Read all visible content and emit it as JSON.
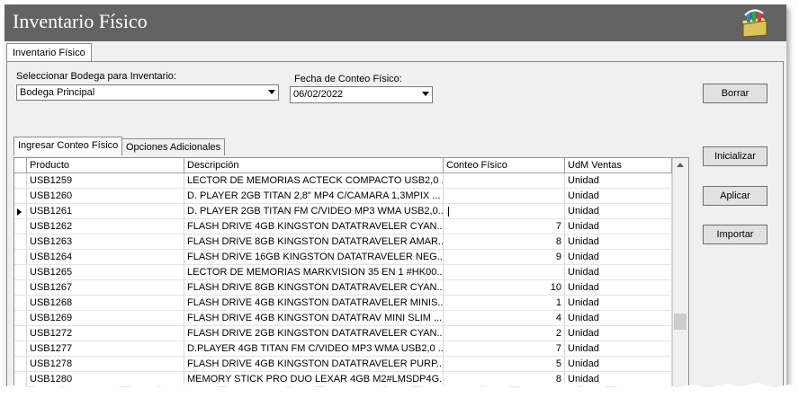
{
  "window": {
    "title": "Inventario Físico",
    "tab": "Inventario Físico",
    "icon": "inventory-app-icon"
  },
  "bodega": {
    "label": "Seleccionar Bodega para Inventario:",
    "value": "Bodega Principal"
  },
  "fecha": {
    "label": "Fecha de Conteo Físico:",
    "value": "06/02/2022"
  },
  "buttons": {
    "borrar": "Borrar",
    "inicializar": "Inicializar",
    "aplicar": "Aplicar",
    "importar": "Importar"
  },
  "tabs": [
    {
      "label": "Ingresar Conteo Físico"
    },
    {
      "label": "Opciones Adicionales"
    }
  ],
  "grid": {
    "columns": [
      "Producto",
      "Descripción",
      "Conteo Físico",
      "UdM Ventas"
    ],
    "rows": [
      {
        "producto": "USB1259",
        "descripcion": "LECTOR DE MEMORIAS ACTECK COMPACTO USB2,0 ...",
        "conteo": "",
        "udm": "Unidad"
      },
      {
        "producto": "USB1260",
        "descripcion": "D. PLAYER 2GB TITAN 2,8\" MP4 C/CAMARA 1,3MPIX ...",
        "conteo": "",
        "udm": "Unidad"
      },
      {
        "producto": "USB1261",
        "descripcion": "D. PLAYER 2GB TITAN FM C/VIDEO MP3 WMA USB2,0...",
        "conteo": "",
        "udm": "Unidad"
      },
      {
        "producto": "USB1262",
        "descripcion": "FLASH DRIVE 4GB KINGSTON DATATRAVELER CYAN...",
        "conteo": "7",
        "udm": "Unidad"
      },
      {
        "producto": "USB1263",
        "descripcion": "FLASH DRIVE 8GB KINGSTON DATATRAVELER AMAR...",
        "conteo": "8",
        "udm": "Unidad"
      },
      {
        "producto": "USB1264",
        "descripcion": "FLASH DRIVE 16GB KINGSTON DATATRAVELER NEG...",
        "conteo": "9",
        "udm": "Unidad"
      },
      {
        "producto": "USB1265",
        "descripcion": "LECTOR DE MEMORIAS MARKVISION 35 EN 1 #HK00...",
        "conteo": "",
        "udm": "Unidad"
      },
      {
        "producto": "USB1267",
        "descripcion": "FLASH DRIVE 8GB KINGSTON DATATRAVELER CYAN...",
        "conteo": "10",
        "udm": "Unidad"
      },
      {
        "producto": "USB1268",
        "descripcion": "FLASH DRIVE 4GB KINGSTON DATATRAVELER MINIS...",
        "conteo": "1",
        "udm": "Unidad"
      },
      {
        "producto": "USB1269",
        "descripcion": "FLASH DRIVE 4GB KINGSTON DATATRAV MINI SLIM ...",
        "conteo": "4",
        "udm": "Unidad"
      },
      {
        "producto": "USB1272",
        "descripcion": "FLASH DRIVE 2GB KINGSTON DATATRAVELER CYAN...",
        "conteo": "2",
        "udm": "Unidad"
      },
      {
        "producto": "USB1277",
        "descripcion": "D.PLAYER 4GB TITAN FM C/VIDEO MP3 WMA USB2,0 ...",
        "conteo": "7",
        "udm": "Unidad"
      },
      {
        "producto": "USB1278",
        "descripcion": "FLASH DRIVE 4GB KINGSTON DATATRAVELER PURP...",
        "conteo": "5",
        "udm": "Unidad"
      },
      {
        "producto": "USB1280",
        "descripcion": "MEMORY STICK PRO DUO LEXAR 4GB M2#LMSDP4G...",
        "conteo": "8",
        "udm": "Unidad"
      }
    ]
  }
}
